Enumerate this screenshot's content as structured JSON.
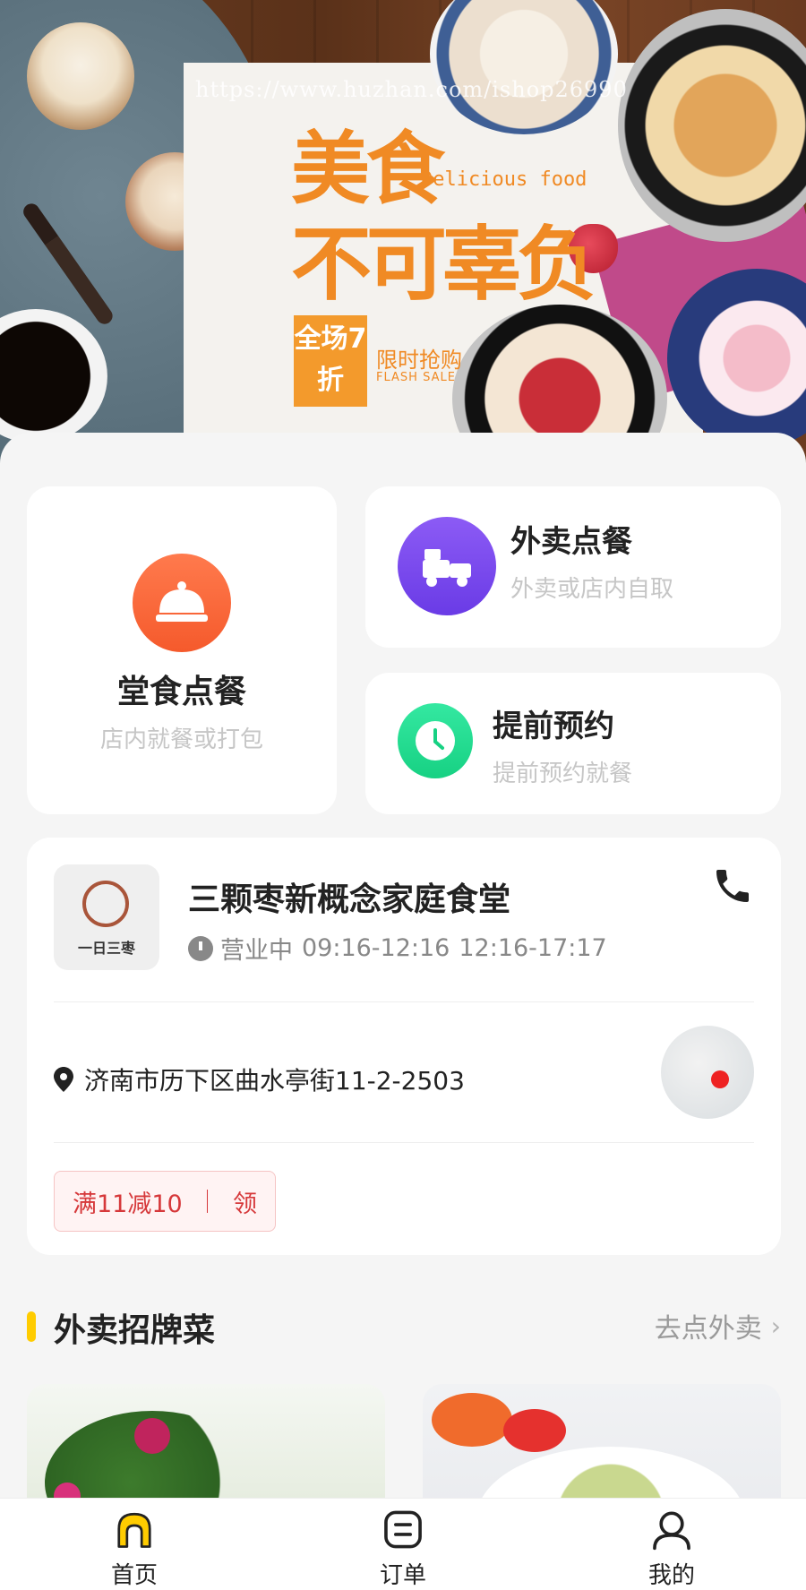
{
  "banner": {
    "watermark": "https://www.huzhan.com/ishop26990",
    "title_line1": "美食",
    "title_line2": "不可辜负",
    "subtitle_en": "Delicious food",
    "sale_badge": "全场7折",
    "flash_cn": "限时抢购",
    "flash_en": "FLASH SALE"
  },
  "services": {
    "dine_in": {
      "title": "堂食点餐",
      "desc": "店内就餐或打包"
    },
    "takeout": {
      "title": "外卖点餐",
      "desc": "外卖或店内自取"
    },
    "reserve": {
      "title": "提前预约",
      "desc": "提前预约就餐"
    }
  },
  "store": {
    "logo_text": "一日三枣",
    "name": "三颗枣新概念家庭食堂",
    "status": "营业中",
    "hours": [
      "09:16-12:16",
      "12:16-17:17"
    ],
    "address": "济南市历下区曲水亭街11-2-2503",
    "coupon_amount": "满11减10",
    "coupon_action": "领"
  },
  "section": {
    "title": "外卖招牌菜",
    "more": "去点外卖",
    "chevron": "›"
  },
  "tabs": [
    {
      "label": "首页",
      "icon": "home-icon",
      "active": true
    },
    {
      "label": "订单",
      "icon": "order-icon",
      "active": false
    },
    {
      "label": "我的",
      "icon": "profile-icon",
      "active": false
    }
  ],
  "colors": {
    "accent_yellow": "#ffcc00",
    "dine_orange": "#f55a2c",
    "takeout_purple": "#6a3be6",
    "reserve_green": "#17d183",
    "coupon_red": "#d6383a",
    "banner_orange": "#f08a24"
  }
}
